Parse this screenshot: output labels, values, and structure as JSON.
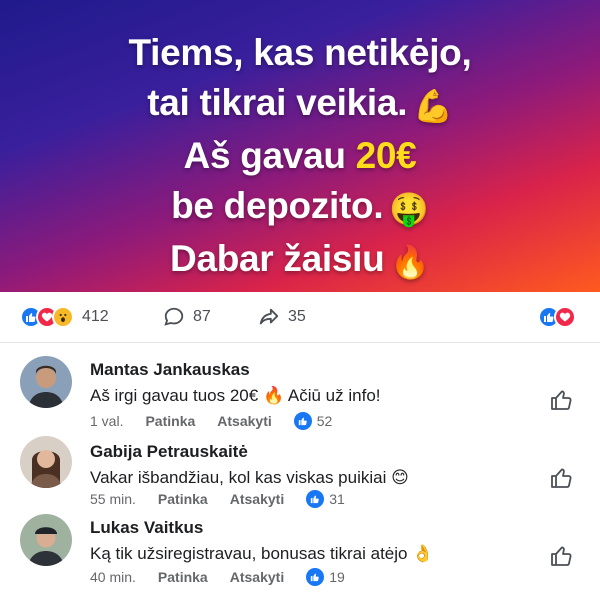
{
  "hero": {
    "line1": "Tiems, kas netikėjo,",
    "line2": "tai tikrai veikia.",
    "line3_pre": "Aš gavau ",
    "line3_amount": "20€",
    "line4": "be depozito.",
    "line5": "Dabar žaisiu",
    "emoji_muscle": "💪",
    "emoji_money": "🤑",
    "emoji_fire": "🔥"
  },
  "reactions": {
    "count": "412",
    "comments": "87",
    "shares": "35",
    "icons": [
      "like-icon",
      "love-icon",
      "wow-icon"
    ]
  },
  "comments": [
    {
      "name": "Mantas Jankauskas",
      "text": "Aš irgi gavau tuos 20€ 🔥 Ačiū už info!",
      "time": "1 val.",
      "like": "Patinka",
      "reply": "Atsakyti",
      "likes": "52"
    },
    {
      "name": "Gabija Petrauskaitė",
      "text": "Vakar išbandžiau, kol kas viskas puikiai 😊",
      "time": "55 min.",
      "like": "Patinka",
      "reply": "Atsakyti",
      "likes": "31"
    },
    {
      "name": "Lukas Vaitkus",
      "text": "Ką tik užsiregistravau, bonusas tikrai atėjo 👌",
      "time": "40 min.",
      "like": "Patinka",
      "reply": "Atsakyti",
      "likes": "19"
    }
  ],
  "colors": {
    "accent": "#1877f2",
    "love": "#f0284a",
    "highlight": "#ffdd1a"
  }
}
